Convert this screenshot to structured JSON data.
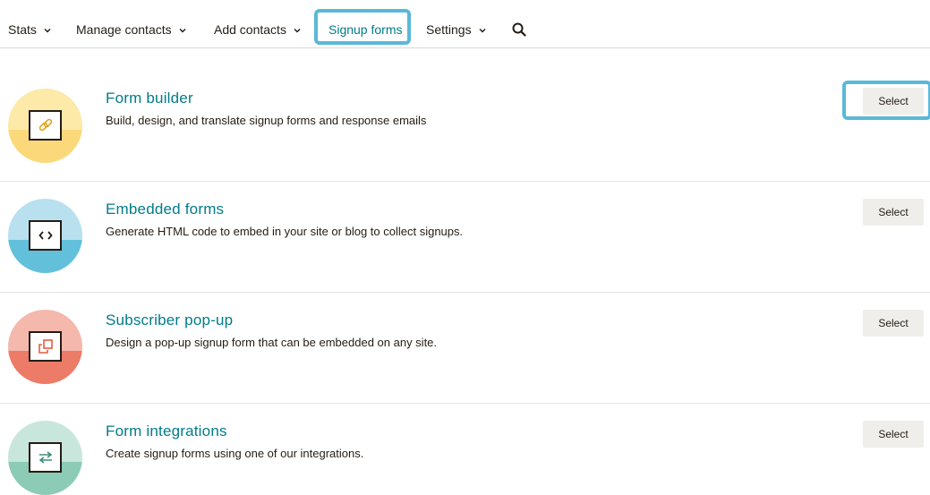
{
  "nav": {
    "items": [
      {
        "label": "Stats",
        "dropdown": true
      },
      {
        "label": "Manage contacts",
        "dropdown": true
      },
      {
        "label": "Add contacts",
        "dropdown": true
      },
      {
        "label": "Signup forms",
        "dropdown": false,
        "active": true
      },
      {
        "label": "Settings",
        "dropdown": true
      }
    ],
    "search_icon": "search-icon"
  },
  "rows": [
    {
      "title": "Form builder",
      "description": "Build, design, and translate signup forms and response emails",
      "button": "Select",
      "icon": "link-icon",
      "colors": {
        "top": "#fde9a8",
        "bottom": "#fbd97a",
        "glyph": "#e3a21a"
      }
    },
    {
      "title": "Embedded forms",
      "description": "Generate HTML code to embed in your site or blog to collect signups.",
      "button": "Select",
      "icon": "code-icon",
      "colors": {
        "top": "#b9e0ef",
        "bottom": "#62c0db",
        "glyph": "#241c15"
      }
    },
    {
      "title": "Subscriber pop-up",
      "description": "Design a pop-up signup form that can be embedded on any site.",
      "button": "Select",
      "icon": "popup-icon",
      "colors": {
        "top": "#f4b8ad",
        "bottom": "#ec7b68",
        "glyph": "#e85c41"
      }
    },
    {
      "title": "Form integrations",
      "description": "Create signup forms using one of our integrations.",
      "button": "Select",
      "icon": "swap-arrows-icon",
      "colors": {
        "top": "#c8e6dc",
        "bottom": "#8ccbb6",
        "glyph": "#3f8f78"
      }
    }
  ],
  "accent": "#007c89",
  "highlight_color": "#5ab8d9"
}
